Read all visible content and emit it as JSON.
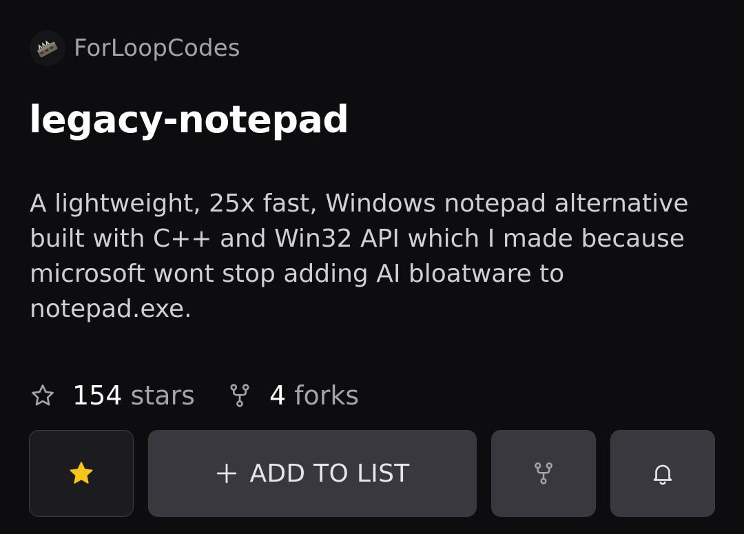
{
  "repo": {
    "owner": "ForLoopCodes",
    "name": "legacy-notepad",
    "description": "A lightweight, 25x fast, Windows notepad alternative built with C++ and Win32 API which I made because microsoft wont stop adding AI bloatware to notepad.exe."
  },
  "stats": {
    "stars_count": "154",
    "stars_label": "stars",
    "forks_count": "4",
    "forks_label": "forks"
  },
  "actions": {
    "star_icon": "star-filled-icon",
    "add_to_list_label": "ADD TO LIST",
    "fork_icon": "fork-icon",
    "watch_icon": "bell-icon"
  },
  "colors": {
    "background": "#0d0d10",
    "star_accent": "#f5c518",
    "button_bg": "#38383e",
    "muted_text": "#a3a3a9"
  }
}
